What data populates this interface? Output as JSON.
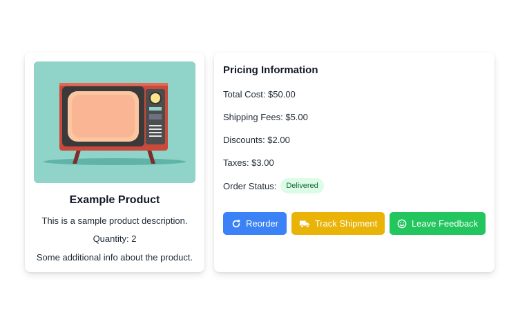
{
  "product": {
    "image_alt": "retro-tv",
    "title": "Example Product",
    "description": "This is a sample product description.",
    "quantity": "Quantity: 2",
    "additional_info": "Some additional info about the product."
  },
  "pricing": {
    "title": "Pricing Information",
    "total_cost": "Total Cost: $50.00",
    "shipping_fees": "Shipping Fees: $5.00",
    "discounts": "Discounts: $2.00",
    "taxes": "Taxes: $3.00",
    "order_status_label": "Order Status:",
    "order_status_value": "Delivered"
  },
  "actions": {
    "reorder": "Reorder",
    "track_shipment": "Track Shipment",
    "leave_feedback": "Leave Feedback"
  },
  "colors": {
    "reorder": "#3b82f6",
    "track": "#eab308",
    "feedback": "#22c55e",
    "status_badge_bg": "#dcfce7"
  },
  "icons": {
    "reorder": "refresh-icon",
    "track": "truck-icon",
    "feedback": "smile-icon"
  }
}
